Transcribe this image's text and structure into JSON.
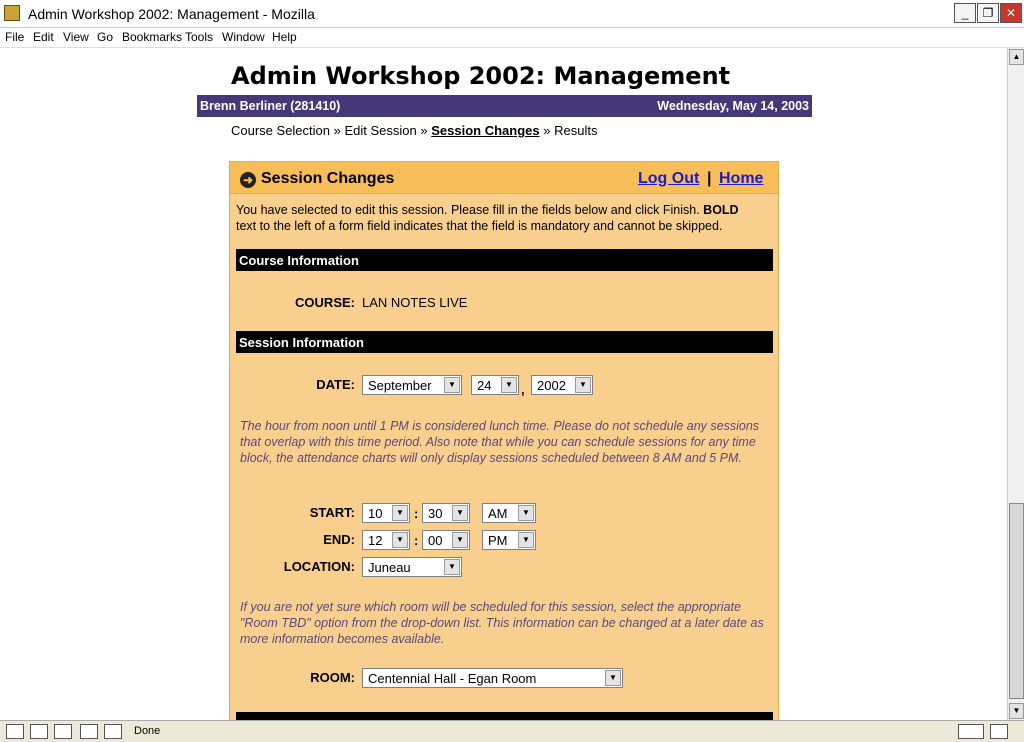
{
  "window": {
    "title": "Admin Workshop 2002: Management - Mozilla"
  },
  "menu": [
    "File",
    "Edit",
    "View",
    "Go",
    "Bookmarks",
    "Tools",
    "Window",
    "Help"
  ],
  "page": {
    "title": "Admin Workshop 2002: Management",
    "user": "Brenn Berliner (281410)",
    "date": "Wednesday, May 14, 2003",
    "breadcrumb": {
      "course_selection": "Course Selection",
      "edit_session": "Edit Session",
      "session_changes": "Session Changes",
      "results": "Results",
      "sep": "»"
    }
  },
  "panel": {
    "title": "Session Changes",
    "logout": "Log Out",
    "home": "Home",
    "intro_text": "You have selected to edit this session. Please fill in the fields below and click Finish.",
    "intro_bold": "BOLD",
    "intro_text2": "text to the left of a form field indicates that the field is mandatory and cannot be skipped.",
    "course_band": "Course Information",
    "course_label": "COURSE:",
    "course_value": "LAN NOTES LIVE",
    "session_band": "Session Information",
    "date_label": "DATE:",
    "date_month": "September",
    "date_day": "24",
    "date_year": "2002",
    "lunch_note": "The hour from noon until 1 PM is considered lunch time. Please do not schedule any sessions that overlap with this time period. Also note that while you can schedule sessions for any time block, the attendance charts will only display sessions scheduled between 8 AM and 5 PM.",
    "start_label": "START:",
    "start_hour": "10",
    "start_min": "30",
    "start_ampm": "AM",
    "end_label": "END:",
    "end_hour": "12",
    "end_min": "00",
    "end_ampm": "PM",
    "location_label": "LOCATION:",
    "location_value": "Juneau",
    "room_note": "If you are not yet sure which room will be scheduled for this session, select the appropriate \"Room TBD\" option from the drop-down list. This information can be changed at a later date as more information becomes available.",
    "room_label": "ROOM:",
    "room_value": "Centennial Hall - Egan Room"
  },
  "status": {
    "text": "Done"
  }
}
